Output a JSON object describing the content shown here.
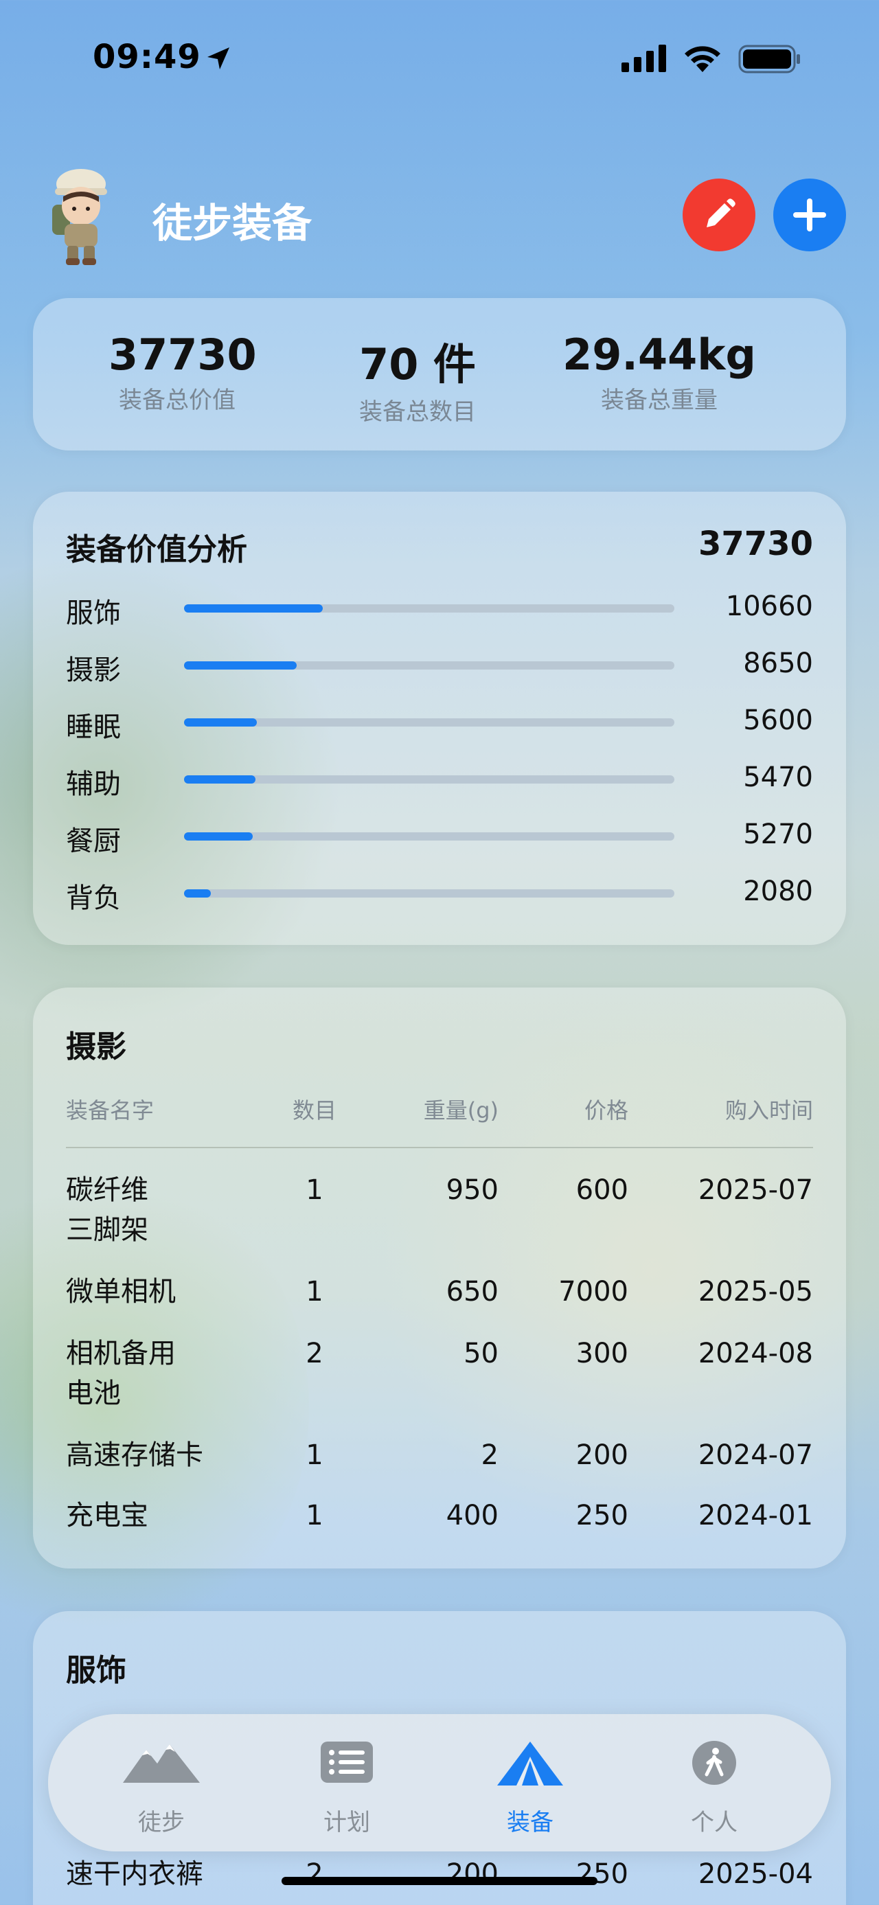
{
  "status": {
    "time": "09:49"
  },
  "header": {
    "title": "徒步装备"
  },
  "summary": [
    {
      "value": "37730",
      "label": "装备总价值"
    },
    {
      "value": "70 件",
      "label": "装备总数目"
    },
    {
      "value": "29.44kg",
      "label": "装备总重量"
    }
  ],
  "analysis": {
    "title": "装备价值分析",
    "total": "37730",
    "rows": [
      {
        "label": "服饰",
        "value": "10660",
        "fraction": 0.2825
      },
      {
        "label": "摄影",
        "value": "8650",
        "fraction": 0.2293
      },
      {
        "label": "睡眠",
        "value": "5600",
        "fraction": 0.1484
      },
      {
        "label": "辅助",
        "value": "5470",
        "fraction": 0.145
      },
      {
        "label": "餐厨",
        "value": "5270",
        "fraction": 0.1397
      },
      {
        "label": "背负",
        "value": "2080",
        "fraction": 0.0551
      }
    ]
  },
  "photo": {
    "title": "摄影",
    "headers": {
      "name": "装备名字",
      "count": "数目",
      "weight": "重量(g)",
      "price": "价格",
      "date": "购入时间"
    },
    "rows": [
      {
        "name": "碳纤维\n三脚架",
        "count": "1",
        "weight": "950",
        "price": "600",
        "date": "2025-07"
      },
      {
        "name": "微单相机",
        "count": "1",
        "weight": "650",
        "price": "7000",
        "date": "2025-05"
      },
      {
        "name": "相机备用\n电池",
        "count": "2",
        "weight": "50",
        "price": "300",
        "date": "2024-08"
      },
      {
        "name": "高速存储卡",
        "count": "1",
        "weight": "2",
        "price": "200",
        "date": "2024-07"
      },
      {
        "name": "充电宝",
        "count": "1",
        "weight": "400",
        "price": "250",
        "date": "2024-01"
      }
    ]
  },
  "apparel": {
    "title": "服饰",
    "rows": [
      {
        "name": "速干内衣裤",
        "count": "2",
        "weight": "200",
        "price": "250",
        "date": "2025-04"
      }
    ]
  },
  "tabs": [
    {
      "label": "徒步",
      "icon": "mountain-icon"
    },
    {
      "label": "计划",
      "icon": "list-icon"
    },
    {
      "label": "装备",
      "icon": "tent-icon",
      "active": true
    },
    {
      "label": "个人",
      "icon": "person-walking-icon"
    }
  ],
  "colors": {
    "accent": "#1a7ef2",
    "edit": "#f23a30",
    "track": "#b9c7d3"
  }
}
